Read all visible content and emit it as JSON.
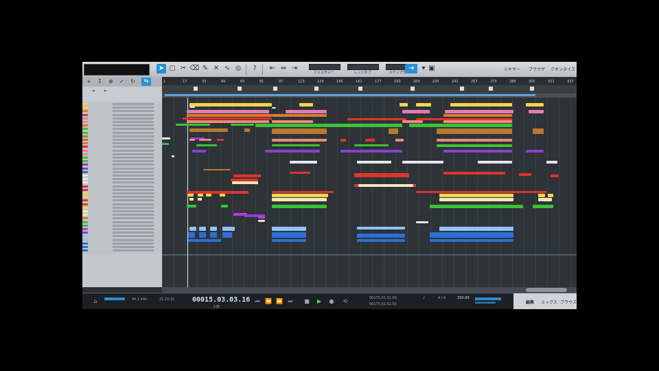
{
  "toolbar": {
    "mini_buttons": [
      {
        "label": "ジェスチャー"
      },
      {
        "label": "レンジタブ"
      },
      {
        "label": "スナップモード"
      }
    ],
    "right_labels": [
      "ミキサー",
      "ブラウザ",
      "クオンタイズ"
    ]
  },
  "transport": {
    "sample_rate": "44.1 kHz",
    "timecode": "21:21:31",
    "position": "00015.03.03.16",
    "position_label": "小節",
    "loop_start": "00175.01.01.00",
    "loop_end": "00175.01.01.00",
    "tempo": "250.00",
    "meter": "4 / 4",
    "right_labels": [
      "編集",
      "ミックス",
      "ブラウズ"
    ]
  },
  "ruler": {
    "bars": [
      "1",
      "17",
      "33",
      "49",
      "65",
      "81",
      "97",
      "113",
      "129",
      "145",
      "161",
      "177",
      "193",
      "209",
      "225",
      "241",
      "257",
      "273",
      "289",
      "305",
      "321",
      "337"
    ]
  },
  "colors": {
    "yellow": "#f2d64a",
    "orange": "#e07b2a",
    "red": "#e0342c",
    "pink": "#e47bb5",
    "green": "#3bc236",
    "brown": "#b8792e",
    "purple": "#8a3fd1",
    "white": "#e6e6e6",
    "cream": "#f2e8b3",
    "blue": "#2f6ed6",
    "lightblue": "#8fc3f2",
    "magenta": "#b63fd6",
    "salmon": "#f08a7a"
  }
}
